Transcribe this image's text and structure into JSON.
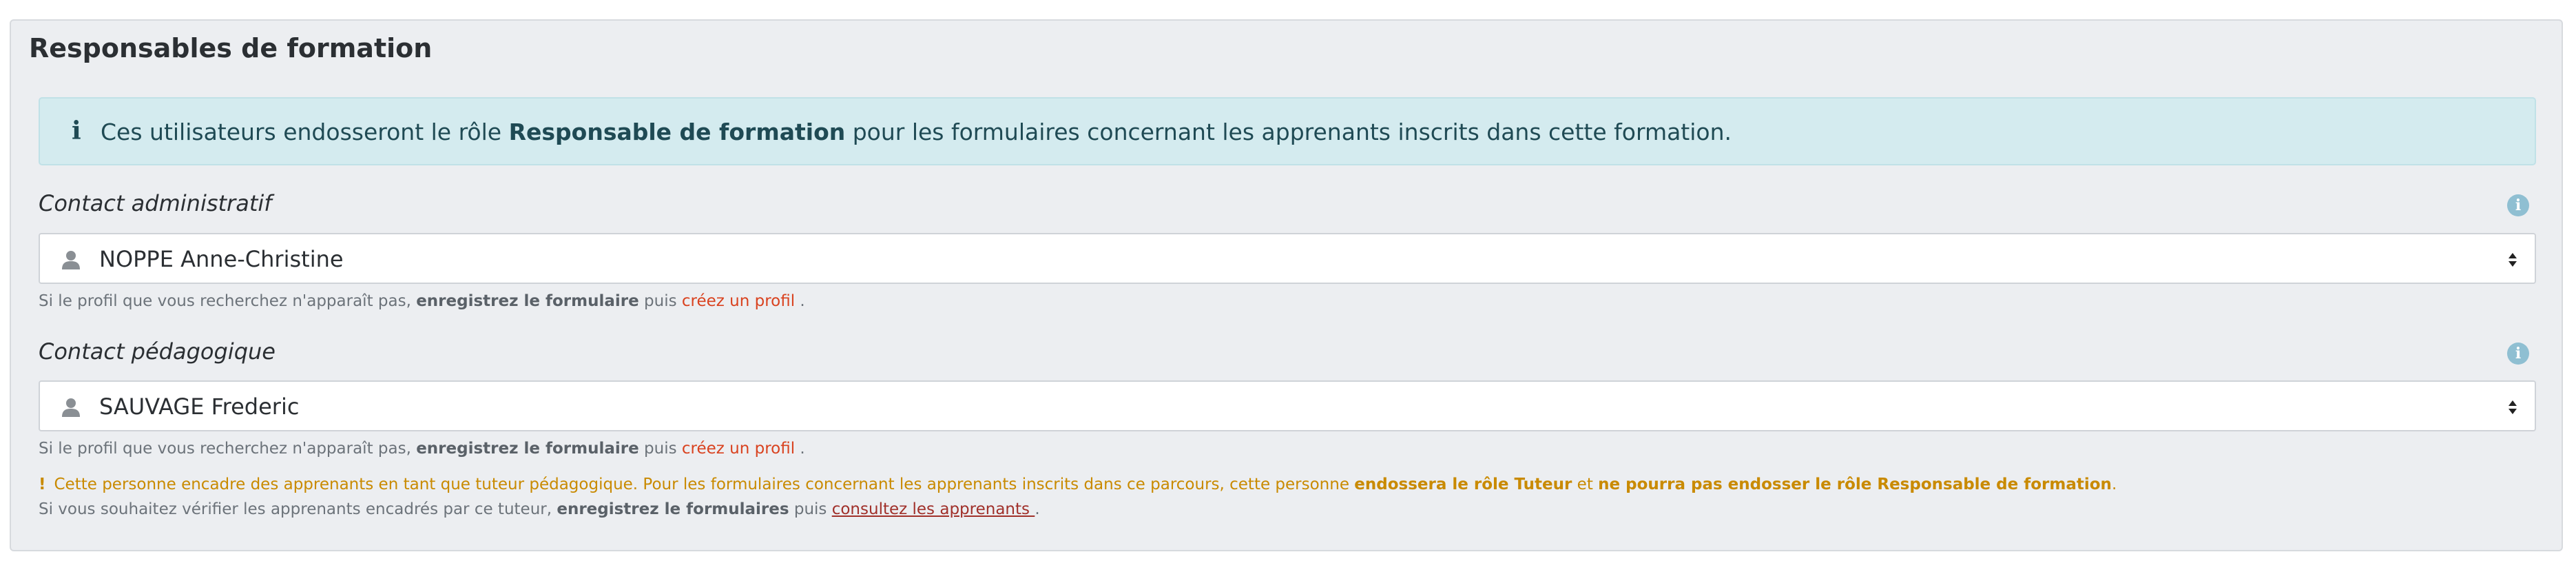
{
  "section": {
    "title": "Responsables de formation"
  },
  "alert": {
    "icon": "info-icon",
    "text_before": "Ces utilisateurs endosseront le rôle ",
    "text_bold": "Responsable de formation",
    "text_after": " pour les formulaires concernant les apprenants inscrits dans cette formation."
  },
  "help": {
    "prefix": "Si le profil que vous recherchez n'apparaît pas, ",
    "save_bold": "enregistrez le formulaire",
    "middle": " puis ",
    "create_link": "créez un profil",
    "suffix": " ."
  },
  "admin_contact": {
    "label": "Contact administratif",
    "value": "NOPPE Anne-Christine"
  },
  "pedago_contact": {
    "label": "Contact pédagogique",
    "value": "SAUVAGE Frederic"
  },
  "warning": {
    "mark": "!",
    "text1": "Cette personne encadre des apprenants en tant que tuteur pédagogique. Pour les formulaires concernant les apprenants inscrits dans ce parcours, cette personne ",
    "bold1": "endossera le rôle Tuteur",
    "text2": " et ",
    "bold2": "ne pourra pas endosser le rôle Responsable de formation",
    "text3": ".",
    "line2_prefix": "Si vous souhaitez vérifier les apprenants encadrés par ce tuteur, ",
    "line2_bold": "enregistrez le formulaires",
    "line2_middle": " puis ",
    "line2_link": "consultez les apprenants ",
    "line2_suffix": "."
  },
  "colors": {
    "alert_bg": "#d4ebef",
    "link_red": "#d9421f",
    "warning_orange": "#c98a00"
  }
}
